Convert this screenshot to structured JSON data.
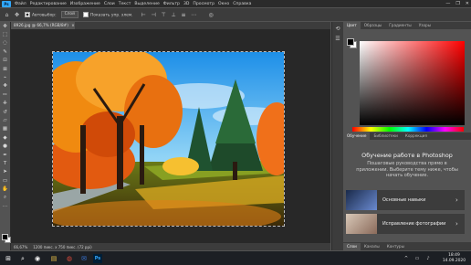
{
  "menubar": {
    "logo": "Ps",
    "items": [
      "Файл",
      "Редактирование",
      "Изображение",
      "Слои",
      "Текст",
      "Выделение",
      "Фильтр",
      "3D",
      "Просмотр",
      "Окно",
      "Справка"
    ],
    "window_controls": [
      "—",
      "❐",
      "✕"
    ]
  },
  "options_bar": {
    "autoselect_label": "Автовыбор:",
    "autoselect_value": "Слой",
    "show_controls_label": "Показать упр. элем."
  },
  "document": {
    "tab_title": "8926.jpg @ 66,7% (RGB/8#)",
    "tab_close": "×",
    "status_zoom": "66,67%",
    "status_info": "1200 пикс. x 750 пикс. (72 ppi)"
  },
  "right_panel": {
    "color_tabs": [
      "Цвет",
      "Образцы",
      "Градиенты",
      "Узоры"
    ],
    "learn_tabs": [
      "Обучение",
      "Библиотеки",
      "Коррекция"
    ],
    "learn_title": "Обучение работе в Photoshop",
    "learn_desc": "Пошаговые руководства прямо в приложении. Выберите тему ниже, чтобы начать обучение.",
    "lessons": [
      {
        "label": "Основные навыки"
      },
      {
        "label": "Исправление фотографии"
      }
    ],
    "bottom_tabs": [
      "Слои",
      "Каналы",
      "Контуры"
    ]
  },
  "taskbar": {
    "time": "18:49",
    "date": "14.09.2020"
  },
  "colors": {
    "accent": "#31a8ff",
    "panel": "#535353",
    "dark": "#2b2b2b"
  }
}
